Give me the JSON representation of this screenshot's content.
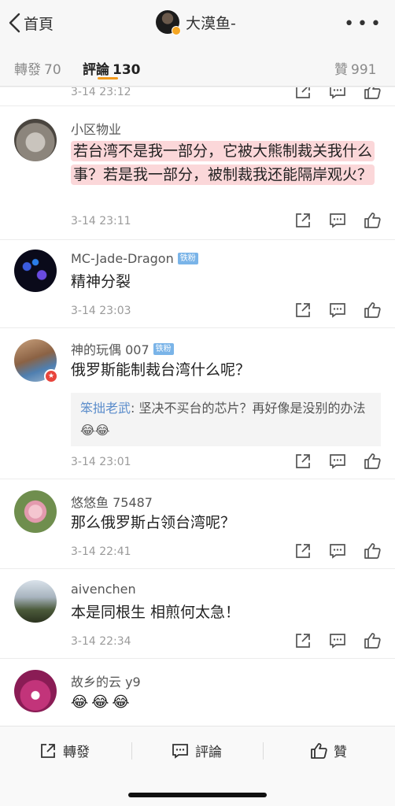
{
  "nav": {
    "back_label": "首頁",
    "author": "大漠鱼-",
    "more_glyph": "•••"
  },
  "tabs": {
    "repost_label": "轉發",
    "repost_count": "70",
    "comment_label": "評論",
    "comment_count": "130",
    "like_label": "贊",
    "like_count": "991"
  },
  "comments": [
    {
      "time": "3-14 23:12"
    },
    {
      "user": "小区物业",
      "text": "若台湾不是我一部分，它被大熊制裁关我什么事？若是我一部分，被制裁我还能隔岸观火？",
      "time": "3-14 23:11"
    },
    {
      "user": "MC-Jade-Dragon",
      "badge": "铁粉",
      "text": "精神分裂",
      "time": "3-14 23:03"
    },
    {
      "user": "神的玩偶 007",
      "badge": "铁粉",
      "text": "俄罗斯能制裁台湾什么呢？",
      "reply_user": "笨拙老武",
      "reply_text": ": 坚决不买台的芯片？再好像是没别的办法",
      "reply_emoji": "😂😂",
      "time": "3-14 23:01"
    },
    {
      "user": "悠悠鱼 75487",
      "text": "那么俄罗斯占领台湾呢？",
      "time": "3-14 22:41"
    },
    {
      "user": "aivenchen",
      "text": "本是同根生 相煎何太急！",
      "time": "3-14 22:34"
    },
    {
      "user": "故乡的云 y9",
      "text": "😂😂😂"
    }
  ],
  "bottom": {
    "repost": "轉發",
    "comment": "評論",
    "like": "贊"
  },
  "colors": {
    "accent": "#f29a1c",
    "highlight": "#fbd7d9",
    "reply_name": "#5a8ccb",
    "fan_badge": "#7ab4e8"
  }
}
